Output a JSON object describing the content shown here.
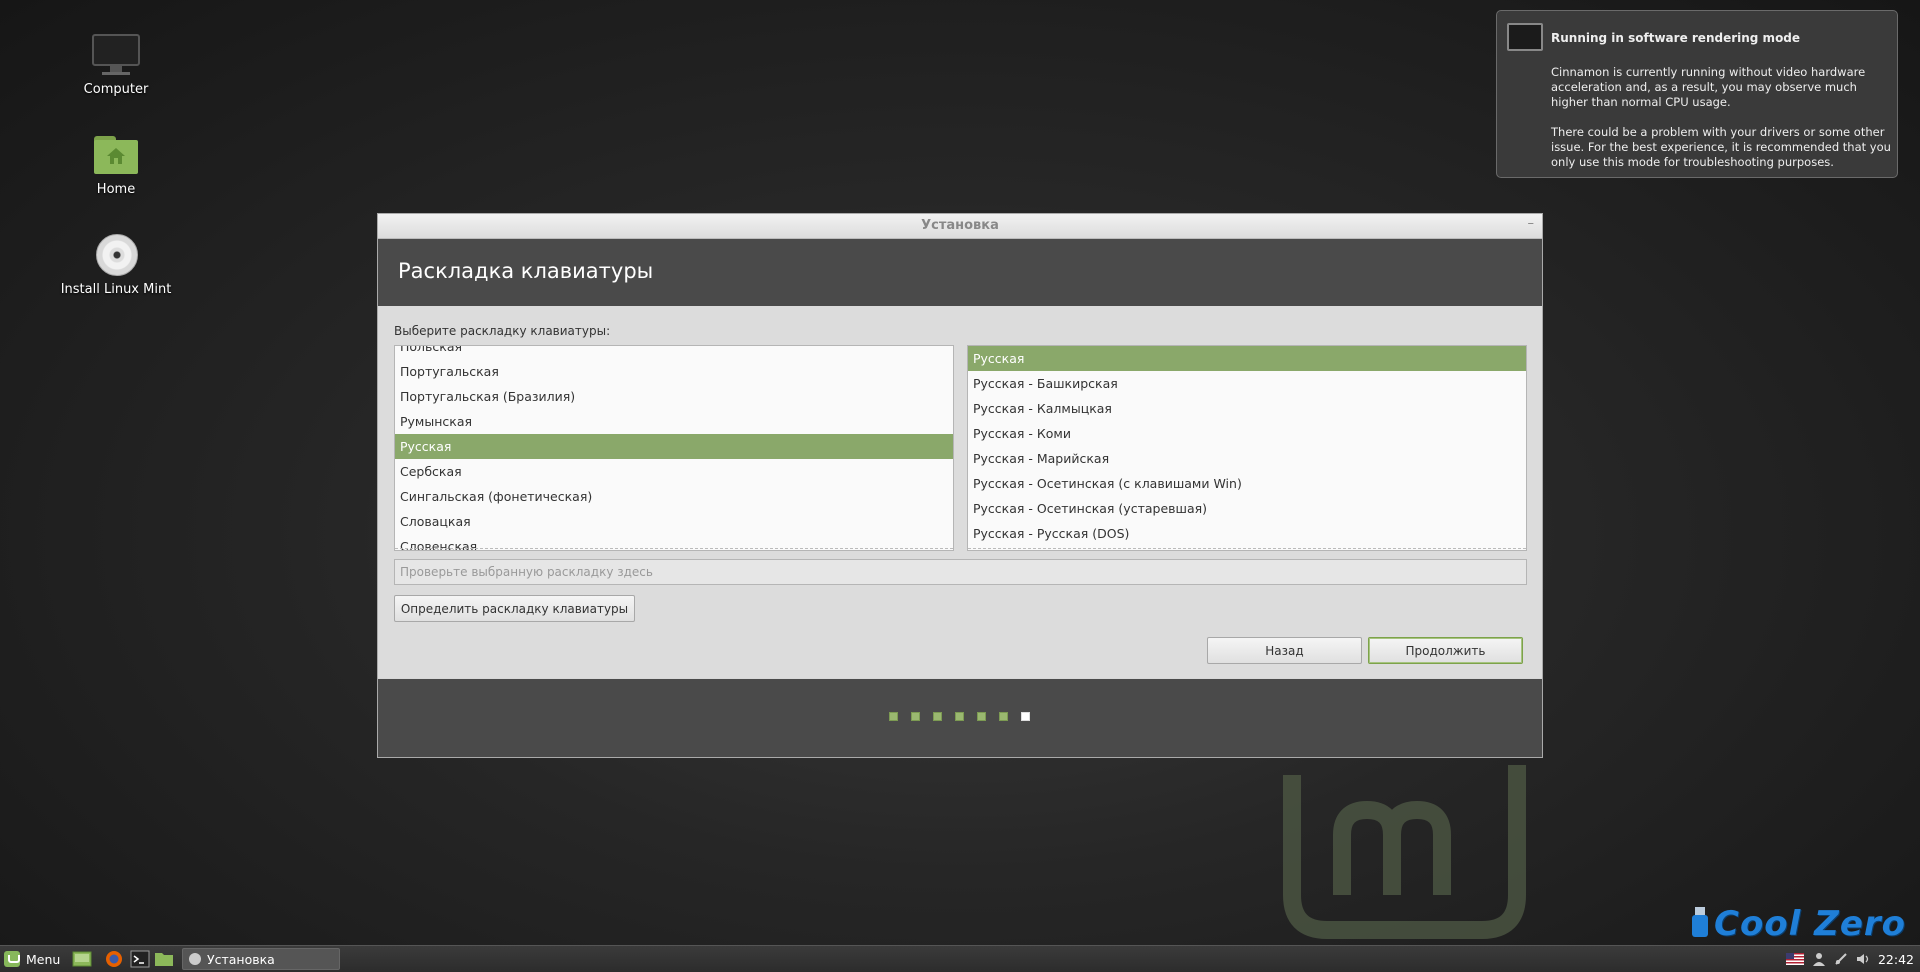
{
  "desktop": {
    "icons": [
      {
        "label": "Computer"
      },
      {
        "label": "Home"
      },
      {
        "label": "Install Linux Mint"
      }
    ]
  },
  "notification": {
    "title": "Running in software rendering mode",
    "body1": "Cinnamon is currently running without video hardware acceleration and, as a result, you may observe much higher than normal CPU usage.",
    "body2": "There could be a problem with your drivers or some other issue.  For the best experience, it is recommended that you only use this mode for troubleshooting purposes."
  },
  "window": {
    "title": "Установка",
    "minimize": "–",
    "heading": "Раскладка клавиатуры",
    "prompt": "Выберите раскладку клавиатуры:",
    "layouts": [
      "Польская",
      "Португальская",
      "Португальская (Бразилия)",
      "Румынская",
      "Русская",
      "Сербская",
      "Сингальская (фонетическая)",
      "Словацкая",
      "Словенская"
    ],
    "selected_layout": "Русская",
    "variants": [
      "Русская",
      "Русская - Башкирская",
      "Русская - Калмыцкая",
      "Русская - Коми",
      "Русская - Марийская",
      "Русская - Осетинская (с клавишами Win)",
      "Русская - Осетинская (устаревшая)",
      "Русская - Русская (DOS)"
    ],
    "selected_variant": "Русская",
    "test_placeholder": "Проверьте выбранную раскладку здесь",
    "detect_button": "Определить раскладку клавиатуры",
    "back_button": "Назад",
    "continue_button": "Продолжить",
    "progress": {
      "total_steps": 7,
      "current_step": 7
    }
  },
  "watermark": {
    "brand": "Cool Zero"
  },
  "taskbar": {
    "menu_label": "Menu",
    "task_label": "Установка",
    "clock": "22:42"
  },
  "colors": {
    "accent": "#8aa86a",
    "panel_dark": "#4a4a4a",
    "brand_blue": "#1f7fd8"
  }
}
